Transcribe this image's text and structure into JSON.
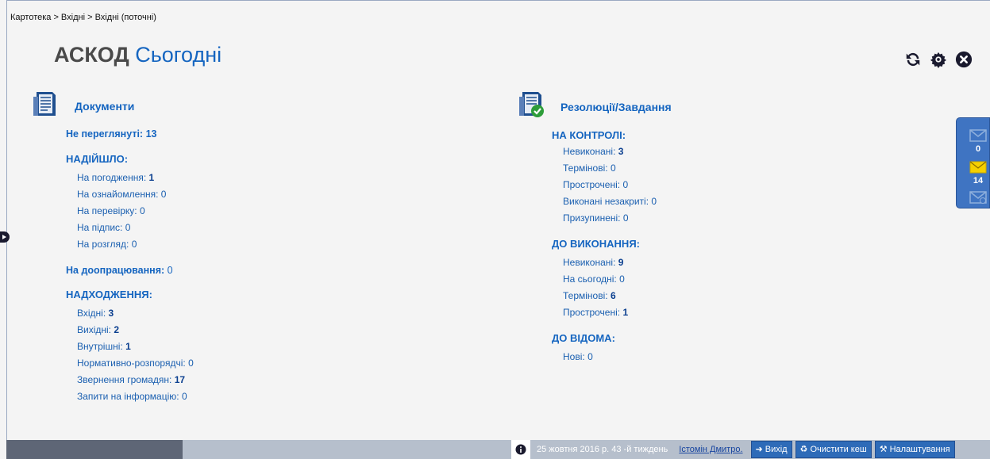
{
  "breadcrumb": "Картотека > Вхідні > Вхідні (поточні)",
  "title": {
    "brand": "АСКОД",
    "today": "Сьогодні"
  },
  "tools": {
    "refresh": "refresh-icon",
    "settings": "gear-icon",
    "close": "close-icon"
  },
  "documents": {
    "label": "Документи",
    "unread_label": "Не переглянуті:",
    "unread_value": "13",
    "arrived_title": "НАДІЙШЛО:",
    "arrived": [
      {
        "label": "На погодження:",
        "value": "1",
        "bold": true
      },
      {
        "label": "На ознайомлення:",
        "value": "0",
        "bold": false
      },
      {
        "label": "На перевірку:",
        "value": "0",
        "bold": false
      },
      {
        "label": "На підпис:",
        "value": "0",
        "bold": false
      },
      {
        "label": "На розгляд:",
        "value": "0",
        "bold": false
      }
    ],
    "rework_label": "На доопрацювання:",
    "rework_value": "0",
    "incoming_title": "НАДХОДЖЕННЯ:",
    "incoming": [
      {
        "label": "Вхідні:",
        "value": "3",
        "bold": true
      },
      {
        "label": "Вихідні:",
        "value": "2",
        "bold": true
      },
      {
        "label": "Внутрішні:",
        "value": "1",
        "bold": true
      },
      {
        "label": "Нормативно-розпорядчі:",
        "value": "0",
        "bold": false
      },
      {
        "label": "Звернення громадян:",
        "value": "17",
        "bold": true
      },
      {
        "label": "Запити на інформацію:",
        "value": "0",
        "bold": false
      }
    ]
  },
  "resolutions": {
    "label": "Резолюції/Завдання",
    "control_title": "НА КОНТРОЛІ:",
    "control": [
      {
        "label": "Невиконані:",
        "value": "3",
        "bold": true
      },
      {
        "label": "Термінові:",
        "value": "0",
        "bold": false
      },
      {
        "label": "Прострочені:",
        "value": "0",
        "bold": false
      },
      {
        "label": "Виконані незакриті:",
        "value": "0",
        "bold": false
      },
      {
        "label": "Призупинені:",
        "value": "0",
        "bold": false
      }
    ],
    "execute_title": "ДО ВИКОНАННЯ:",
    "execute": [
      {
        "label": "Невиконані:",
        "value": "9",
        "bold": true
      },
      {
        "label": "На сьогодні:",
        "value": "0",
        "bold": false
      },
      {
        "label": "Термінові:",
        "value": "6",
        "bold": true
      },
      {
        "label": "Прострочені:",
        "value": "1",
        "bold": true
      }
    ],
    "notice_title": "ДО ВІДОМА:",
    "notice": [
      {
        "label": "Нові:",
        "value": "0",
        "bold": false
      }
    ]
  },
  "mail": [
    {
      "icon": "mail-new-icon",
      "count": "0"
    },
    {
      "icon": "mail-unread-icon",
      "count": "14"
    },
    {
      "icon": "mail-deleted-icon",
      "count": ""
    }
  ],
  "footer": {
    "date": "25 жовтня 2016 р. 43 -й тиждень",
    "user": "Істомін Дмитро.",
    "exit": "Вихід",
    "clear_cache": "Очистити кеш",
    "settings": "Налаштування"
  },
  "colors": {
    "accent": "#1565c0",
    "panel": "#3f74c2",
    "footer": "#b6bfcc"
  }
}
